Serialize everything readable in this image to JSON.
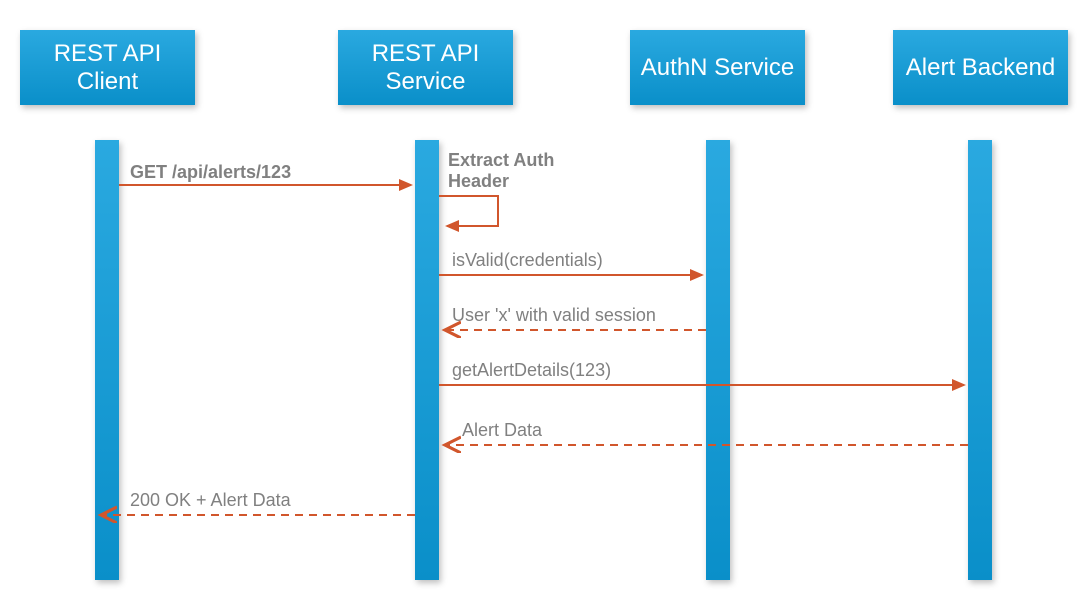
{
  "participants": {
    "p1": "REST API Client",
    "p2": "REST API Service",
    "p3": "AuthN Service",
    "p4": "Alert Backend"
  },
  "messages": {
    "m1": "GET /api/alerts/123",
    "m2": "Extract Auth Header",
    "m3": "isValid(credentials)",
    "m4": "User 'x' with valid session",
    "m5": "getAlertDetails(123)",
    "m6": "Alert Data",
    "m7": "200 OK + Alert Data"
  },
  "colors": {
    "arrow": "#d1562c",
    "text": "#808080",
    "box_top": "#2aa9e0",
    "box_bottom": "#0a8fc9"
  }
}
